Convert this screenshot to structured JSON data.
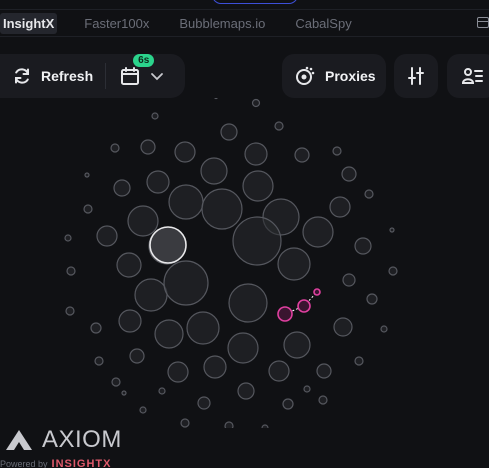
{
  "tabs": [
    {
      "label": "InsightX",
      "active": true
    },
    {
      "label": "Faster100x",
      "active": false
    },
    {
      "label": "Bubblemaps.io",
      "active": false
    },
    {
      "label": "CabalSpy",
      "active": false
    }
  ],
  "toolbar": {
    "refresh_label": "Refresh",
    "interval_badge": "6s",
    "proxies_label": "Proxies",
    "icons": {
      "refresh": "refresh-icon",
      "calendar": "calendar-icon",
      "chevron": "chevron-down-icon",
      "proxies": "proxies-icon",
      "filter": "sliders-icon",
      "list": "user-list-icon"
    }
  },
  "bubble_map": {
    "colors": {
      "node_fill": "#2a2b30",
      "node_stroke": "#55575e",
      "highlight": "#e040a0",
      "highlight_large": "#e8e8ea"
    }
  },
  "branding": {
    "name": "AXIOM",
    "powered_by": "Powered by",
    "partner": "INSIGHTX"
  }
}
